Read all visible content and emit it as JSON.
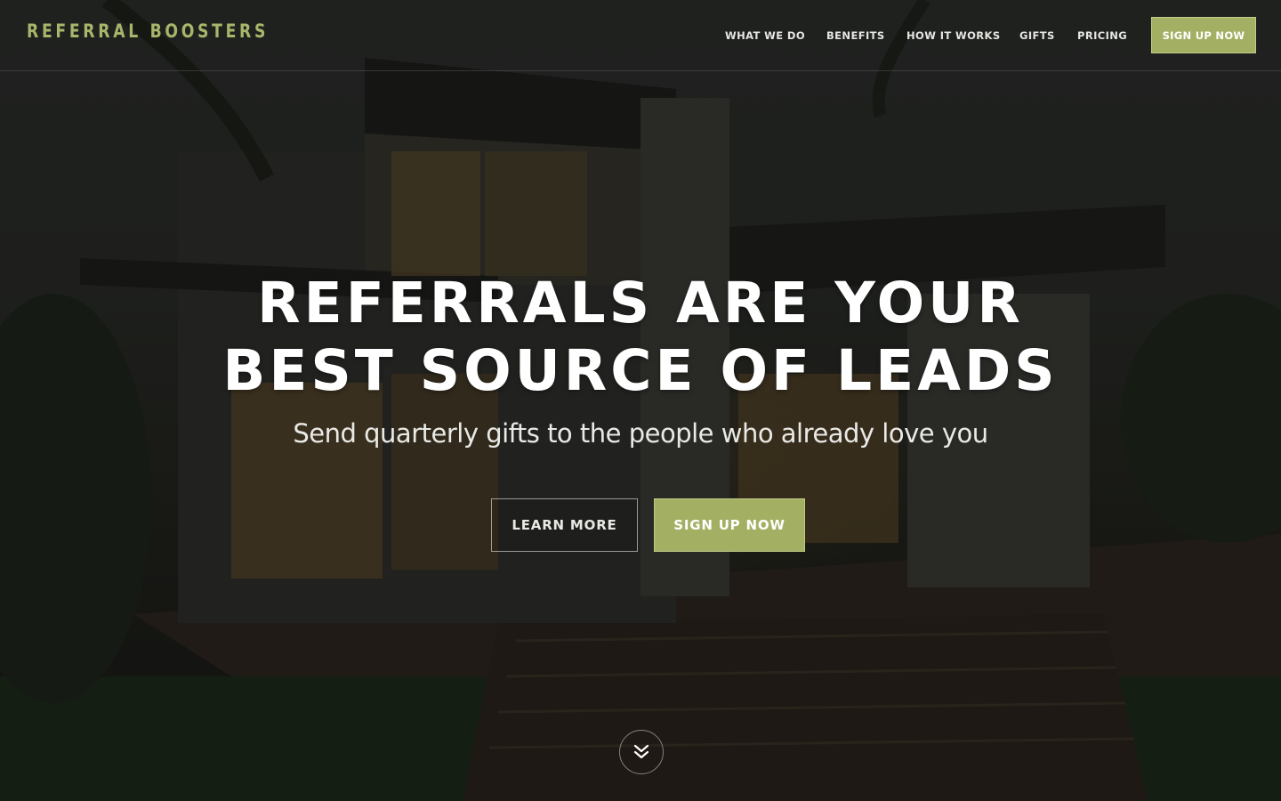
{
  "brand": {
    "name": "REFERRAL BOOSTERS",
    "accent": "#a3b063",
    "logo_color": "#a8b56a"
  },
  "nav": {
    "items": [
      {
        "label": "WHAT WE DO"
      },
      {
        "label": "BENEFITS"
      },
      {
        "label": "HOW IT WORKS"
      },
      {
        "label": "GIFTS"
      },
      {
        "label": "PRICING"
      }
    ],
    "cta_label": "SIGN UP NOW"
  },
  "hero": {
    "title_line1": "REFERRALS ARE YOUR",
    "title_line2": "BEST SOURCE OF LEADS",
    "subtitle": "Send quarterly gifts to the people who already love you",
    "learn_more_label": "LEARN MORE",
    "signup_label": "SIGN UP NOW",
    "scroll_icon": "double-chevron-down-icon"
  }
}
